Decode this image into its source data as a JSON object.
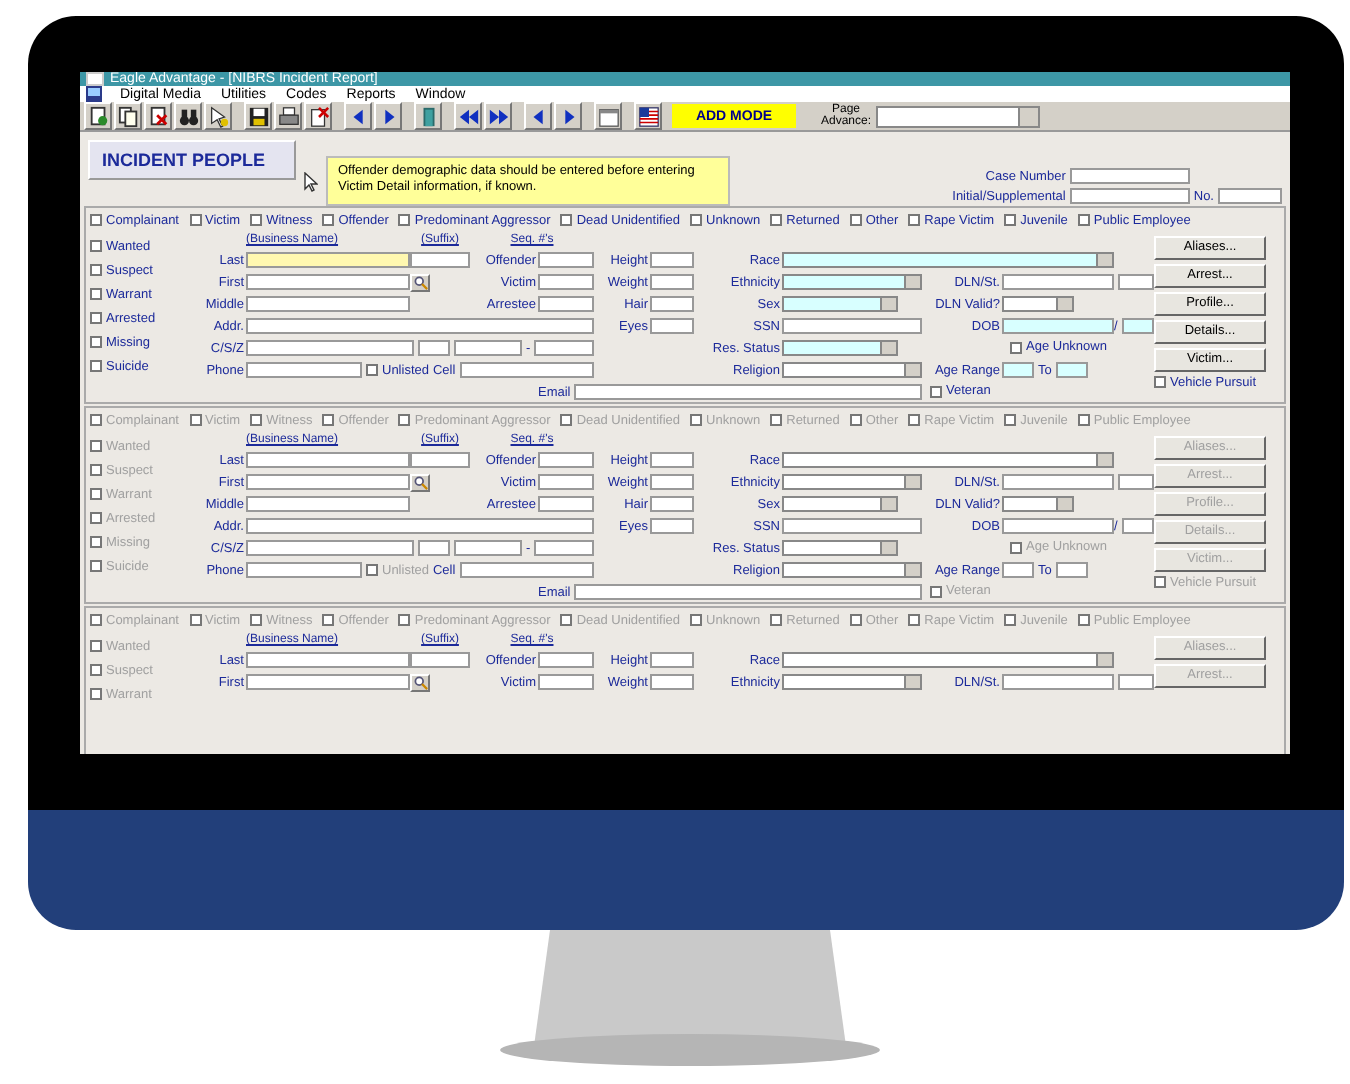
{
  "window": {
    "title": "Eagle Advantage - [NIBRS Incident Report]"
  },
  "menu": [
    "Digital Media",
    "Utilities",
    "Codes",
    "Reports",
    "Window"
  ],
  "toolbar": {
    "mode": "ADD MODE",
    "page_advance_label": "Page Advance:"
  },
  "header": {
    "title": "INCIDENT PEOPLE",
    "notice": "Offender demographic data should be entered before entering Victim Detail information, if known.",
    "case_number_label": "Case Number",
    "initial_label": "Initial/Supplemental",
    "no_label": "No."
  },
  "blocks": [
    {
      "enabled": true,
      "roles": [
        {
          "label": "Complainant",
          "checked": false
        },
        {
          "label": "Victim",
          "checked": false
        },
        {
          "label": "Witness",
          "checked": false
        },
        {
          "label": "Offender",
          "checked": false
        },
        {
          "label": "Predominant Aggressor",
          "checked": false
        },
        {
          "label": "Dead Unidentified",
          "checked": false
        },
        {
          "label": "Unknown",
          "checked": false
        },
        {
          "label": "Returned",
          "checked": false
        },
        {
          "label": "Other",
          "checked": false
        },
        {
          "label": "Rape Victim",
          "checked": false
        },
        {
          "label": "Juvenile",
          "checked": false
        },
        {
          "label": "Public Employee",
          "checked": false
        }
      ],
      "statuses": [
        {
          "label": "Wanted",
          "checked": false
        },
        {
          "label": "Suspect",
          "checked": false
        },
        {
          "label": "Warrant",
          "checked": false
        },
        {
          "label": "Arrested",
          "checked": false
        },
        {
          "label": "Missing",
          "checked": false
        },
        {
          "label": "Suicide",
          "checked": false
        }
      ],
      "name_headers": [
        "(Business Name)",
        "(Suffix)"
      ],
      "seq_header": "Seq. #'s",
      "name_rows": [
        {
          "label": "Last",
          "kind": "name",
          "focused": true
        },
        {
          "label": "First",
          "kind": "lookup"
        },
        {
          "label": "Middle",
          "kind": "single"
        },
        {
          "label": "Addr.",
          "kind": "wide"
        },
        {
          "label": "C/S/Z",
          "kind": "address",
          "separator": "-"
        },
        {
          "label": "Phone",
          "kind": "phone",
          "unlisted": {
            "label": "Unlisted",
            "checked": false
          },
          "cell_label": "Cell"
        }
      ],
      "seq_rows": [
        "Offender",
        "Victim",
        "Arrestee"
      ],
      "body_rows": [
        "Height",
        "Weight",
        "Hair",
        "Eyes"
      ],
      "demo_rows": [
        {
          "label": "Race",
          "kind": "combo",
          "required": true
        },
        {
          "label": "Ethnicity",
          "kind": "combo",
          "required": true
        },
        {
          "label": "Sex",
          "kind": "combo",
          "required": true
        },
        {
          "label": "SSN",
          "kind": "text",
          "required": false
        },
        {
          "label": "Res. Status",
          "kind": "combo",
          "required": true
        },
        {
          "label": "Religion",
          "kind": "combo",
          "required": false
        }
      ],
      "email_label": "Email",
      "veteran": {
        "label": "Veteran",
        "checked": false
      },
      "dl_rows": [
        {
          "label": "DLN/St.",
          "kind": "dln",
          "required": false
        },
        {
          "label": "DLN Valid?",
          "kind": "combo",
          "required": false
        },
        {
          "label": "DOB",
          "kind": "dob",
          "separator": "/",
          "required": true
        },
        {
          "label": "Age Unknown",
          "kind": "check",
          "checked": false
        },
        {
          "label": "Age Range",
          "kind": "range",
          "to_label": "To",
          "required": true
        }
      ],
      "buttons": [
        "Aliases...",
        "Arrest...",
        "Profile...",
        "Details...",
        "Victim..."
      ],
      "vehicle_pursuit": {
        "label": "Vehicle Pursuit",
        "checked": false
      }
    },
    {
      "enabled": false,
      "roles": [
        {
          "label": "Complainant",
          "checked": false
        },
        {
          "label": "Victim",
          "checked": false
        },
        {
          "label": "Witness",
          "checked": false
        },
        {
          "label": "Offender",
          "checked": false
        },
        {
          "label": "Predominant Aggressor",
          "checked": false
        },
        {
          "label": "Dead Unidentified",
          "checked": false
        },
        {
          "label": "Unknown",
          "checked": false
        },
        {
          "label": "Returned",
          "checked": false
        },
        {
          "label": "Other",
          "checked": false
        },
        {
          "label": "Rape Victim",
          "checked": false
        },
        {
          "label": "Juvenile",
          "checked": false
        },
        {
          "label": "Public Employee",
          "checked": false
        }
      ],
      "statuses": [
        {
          "label": "Wanted",
          "checked": false
        },
        {
          "label": "Suspect",
          "checked": false
        },
        {
          "label": "Warrant",
          "checked": false
        },
        {
          "label": "Arrested",
          "checked": false
        },
        {
          "label": "Missing",
          "checked": false
        },
        {
          "label": "Suicide",
          "checked": false
        }
      ],
      "name_headers": [
        "(Business Name)",
        "(Suffix)"
      ],
      "seq_header": "Seq. #'s",
      "name_rows": [
        {
          "label": "Last",
          "kind": "name",
          "focused": false
        },
        {
          "label": "First",
          "kind": "lookup"
        },
        {
          "label": "Middle",
          "kind": "single"
        },
        {
          "label": "Addr.",
          "kind": "wide"
        },
        {
          "label": "C/S/Z",
          "kind": "address",
          "separator": "-"
        },
        {
          "label": "Phone",
          "kind": "phone",
          "unlisted": {
            "label": "Unlisted",
            "checked": false
          },
          "cell_label": "Cell"
        }
      ],
      "seq_rows": [
        "Offender",
        "Victim",
        "Arrestee"
      ],
      "body_rows": [
        "Height",
        "Weight",
        "Hair",
        "Eyes"
      ],
      "demo_rows": [
        {
          "label": "Race",
          "kind": "combo",
          "required": false
        },
        {
          "label": "Ethnicity",
          "kind": "combo",
          "required": false
        },
        {
          "label": "Sex",
          "kind": "combo",
          "required": false
        },
        {
          "label": "SSN",
          "kind": "text",
          "required": false
        },
        {
          "label": "Res. Status",
          "kind": "combo",
          "required": false
        },
        {
          "label": "Religion",
          "kind": "combo",
          "required": false
        }
      ],
      "email_label": "Email",
      "veteran": {
        "label": "Veteran",
        "checked": false
      },
      "dl_rows": [
        {
          "label": "DLN/St.",
          "kind": "dln",
          "required": false
        },
        {
          "label": "DLN Valid?",
          "kind": "combo",
          "required": false
        },
        {
          "label": "DOB",
          "kind": "dob",
          "separator": "/",
          "required": false
        },
        {
          "label": "Age Unknown",
          "kind": "check",
          "checked": false
        },
        {
          "label": "Age Range",
          "kind": "range",
          "to_label": "To",
          "required": false
        }
      ],
      "buttons": [
        "Aliases...",
        "Arrest...",
        "Profile...",
        "Details...",
        "Victim..."
      ],
      "vehicle_pursuit": {
        "label": "Vehicle Pursuit",
        "checked": false
      }
    },
    {
      "enabled": false,
      "roles": [
        {
          "label": "Complainant",
          "checked": false
        },
        {
          "label": "Victim",
          "checked": false
        },
        {
          "label": "Witness",
          "checked": false
        },
        {
          "label": "Offender",
          "checked": false
        },
        {
          "label": "Predominant Aggressor",
          "checked": false
        },
        {
          "label": "Dead Unidentified",
          "checked": false
        },
        {
          "label": "Unknown",
          "checked": false
        },
        {
          "label": "Returned",
          "checked": false
        },
        {
          "label": "Other",
          "checked": false
        },
        {
          "label": "Rape Victim",
          "checked": false
        },
        {
          "label": "Juvenile",
          "checked": false
        },
        {
          "label": "Public Employee",
          "checked": false
        }
      ],
      "statuses": [
        {
          "label": "Wanted",
          "checked": false
        },
        {
          "label": "Suspect",
          "checked": false
        },
        {
          "label": "Warrant",
          "checked": false
        }
      ],
      "name_headers": [
        "(Business Name)",
        "(Suffix)"
      ],
      "seq_header": "Seq. #'s",
      "name_rows": [
        {
          "label": "Last",
          "kind": "name",
          "focused": false
        },
        {
          "label": "First",
          "kind": "lookup"
        }
      ],
      "seq_rows": [
        "Offender",
        "Victim"
      ],
      "body_rows": [
        "Height",
        "Weight"
      ],
      "demo_rows": [
        {
          "label": "Race",
          "kind": "combo",
          "required": false
        },
        {
          "label": "Ethnicity",
          "kind": "combo",
          "required": false
        }
      ],
      "dl_rows": [
        {
          "label": "DLN/St.",
          "kind": "dln",
          "required": false
        }
      ],
      "buttons": [
        "Aliases...",
        "Arrest..."
      ]
    }
  ]
}
